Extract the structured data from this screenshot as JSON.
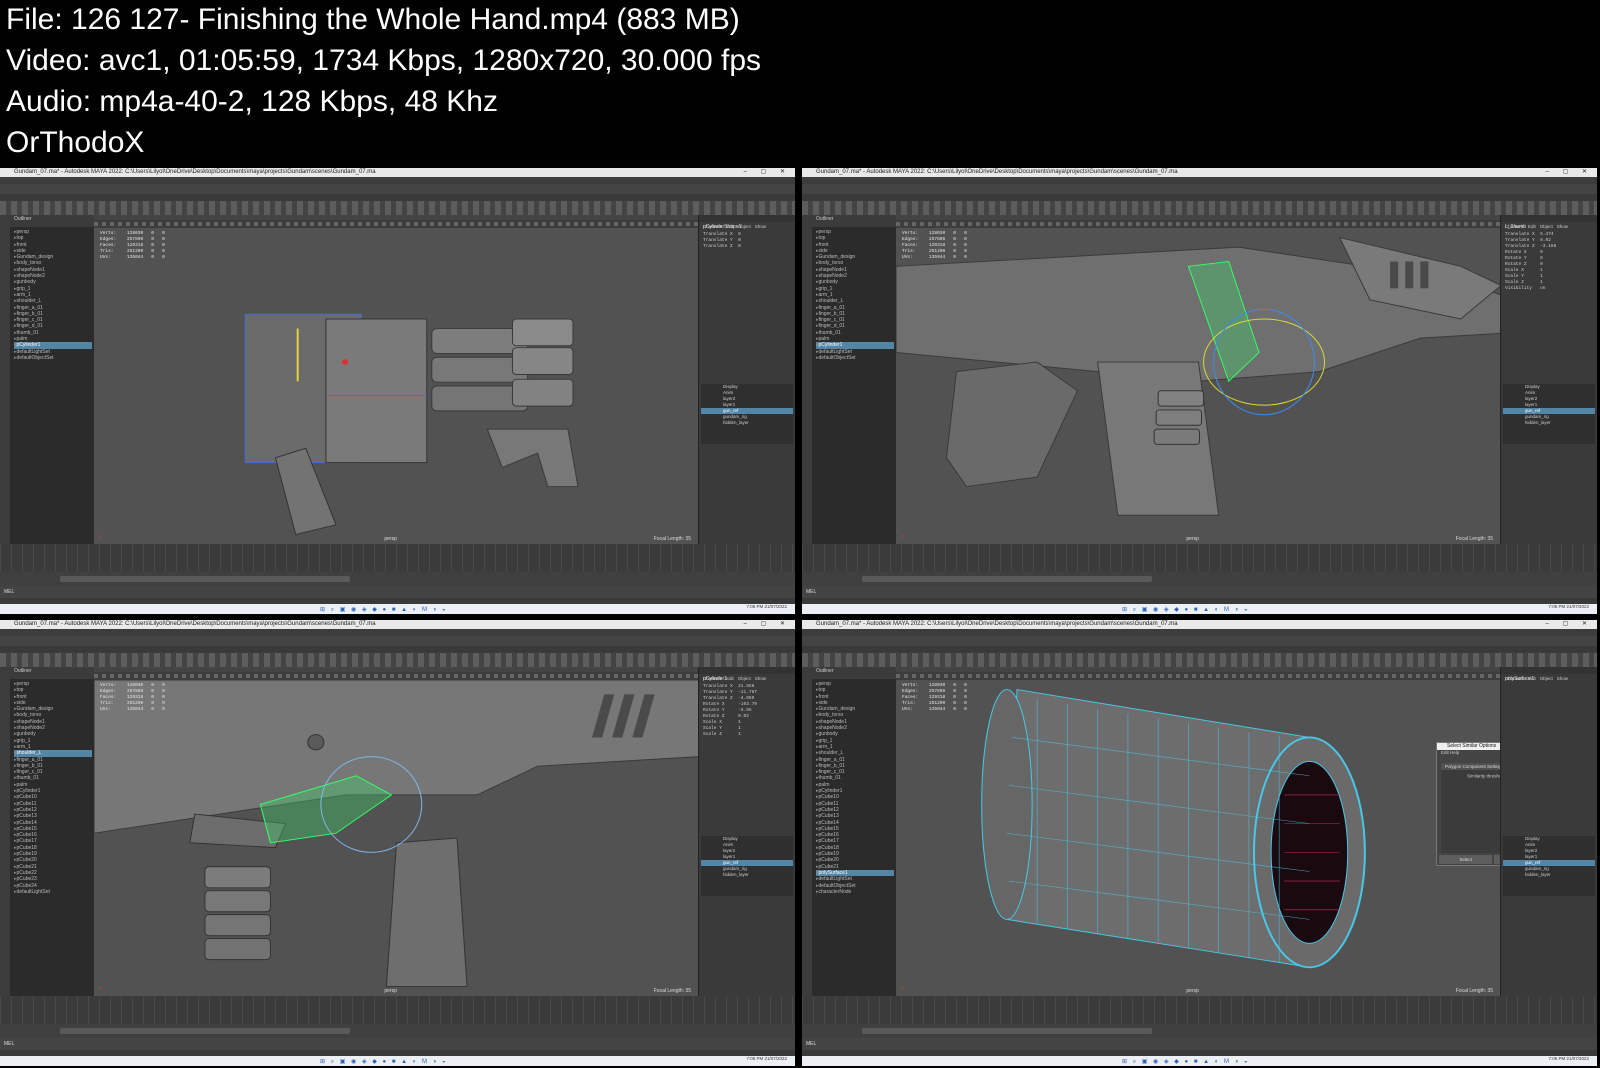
{
  "info": {
    "file_line": "File: 126  127- Finishing the Whole Hand.mp4 (883 MB)",
    "video_line": "Video: avc1, 01:05:59, 1734 Kbps, 1280x720, 30.000 fps",
    "audio_line": "Audio: mp4a-40-2, 128 Kbps, 48 Khz",
    "author": "OrThodoX"
  },
  "maya": {
    "title": "Gundam_07.ma* - Autodesk MAYA 2022: C:\\Users\\Lilyol\\OneDrive\\Desktop\\Documents\\maya\\projects\\Gundam\\scenes\\Gundam_07.ma",
    "window_controls": "– ▢ ✕",
    "menus": [
      "File",
      "Edit",
      "Create",
      "Select",
      "Modify",
      "Display",
      "Windows",
      "Mesh",
      "Edit Mesh",
      "Mesh Tools",
      "Mesh Display",
      "Curves",
      "Surfaces",
      "Deform",
      "UV",
      "Generate",
      "Cache",
      "Arnold",
      "Help"
    ],
    "shelf_tabs": [
      "Curves / Surfaces",
      "Poly Modeling",
      "Sculpting",
      "Rigging",
      "Animation",
      "Rendering",
      "FX",
      "FX Caching",
      "Custom",
      "Arnold",
      "Bifrost",
      "MASH",
      "Motion Graphics",
      "XGen"
    ],
    "panel_menus": [
      "View",
      "Shading",
      "Lighting",
      "Show",
      "Renderer",
      "Panels"
    ],
    "outliner_header": "Outliner",
    "hud": "Verts:    128030   0   0\nEdges:    257896   0   0\nFaces:    129318   0   0\nTris:     251290   0   0\nUVs:      135044   0   0",
    "persp_label": "persp",
    "focal_label": "Focal Length:   35",
    "channel_tabs": [
      "Channels",
      "Edit",
      "Object",
      "Show"
    ],
    "layer_tabs": [
      "Display",
      "Anim"
    ],
    "mel_label": "MEL",
    "taskbar_icons": "⊞ ⌕ ▣ ◉ ◈ ◆ ● ■ ▲ ◐ M ◑ ◒",
    "clock": "7:05 PM\n21/07/2022"
  },
  "shots": [
    {
      "outliner": [
        "persp",
        "top",
        "front",
        "side",
        "Gundam_design",
        "body_torso",
        "shapeNode1",
        "shapeNode2",
        "gunbody",
        "grip_1",
        "arm_1",
        "shoulder_L",
        "finger_a_01",
        "finger_b_01",
        "finger_c_01",
        "finger_d_01",
        "thumb_01",
        "palm",
        "pCylinder1",
        "defaultLightSet",
        "defaultObjectSet"
      ],
      "sel": 18,
      "channel_object": "pCylinderShape1",
      "channel_attrs": "Translate X  0\nTranslate Y  0\nTranslate Z  0",
      "layers": [
        "layer2",
        "layer1",
        "gun_ref",
        "gundam_rig",
        "hidden_layer"
      ]
    },
    {
      "outliner": [
        "persp",
        "top",
        "front",
        "side",
        "Gundam_design",
        "body_torso",
        "shapeNode1",
        "shapeNode2",
        "gunbody",
        "grip_1",
        "arm_1",
        "shoulder_L",
        "finger_a_01",
        "finger_b_01",
        "finger_c_01",
        "finger_d_01",
        "thumb_01",
        "palm",
        "pCylinder1",
        "defaultLightSet",
        "defaultObjectSet"
      ],
      "sel": 18,
      "channel_object": "L_Thumb",
      "channel_attrs": "Translate X  5.474\nTranslate Y  8.02\nTranslate Z  -3.168\nRotate X     0\nRotate Y     0\nRotate Z     0\nScale X      1\nScale Y      1\nScale Z      1\nVisibility   on",
      "layers": [
        "layer2",
        "layer1",
        "gun_ref",
        "gundam_rig",
        "hidden_layer"
      ]
    },
    {
      "outliner": [
        "persp",
        "top",
        "front",
        "side",
        "Gundam_design",
        "body_torso",
        "shapeNode1",
        "shapeNode2",
        "gunbody",
        "grip_1",
        "arm_1",
        "shoulder_L",
        "finger_a_01",
        "finger_b_01",
        "finger_c_01",
        "thumb_01",
        "palm",
        "pCylinder1",
        "pCube10",
        "pCube11",
        "pCube12",
        "pCube13",
        "pCube14",
        "pCube15",
        "pCube16",
        "pCube17",
        "pCube18",
        "pCube19",
        "pCube20",
        "pCube21",
        "pCube22",
        "pCube23",
        "pCube24",
        "defaultLightSet"
      ],
      "sel": 11,
      "channel_object": "pCylinder1",
      "channel_attrs": "Translate X  21.558\nTranslate Y  -11.787\nTranslate Z  -4.069\nRotate X     -103.79\nRotate Y     -5.65\nRotate Z     0.02\nScale X      1\nScale Y      1\nScale Z      1",
      "layers": [
        "layer2",
        "layer1",
        "gun_ref",
        "gundam_rig",
        "hidden_layer"
      ]
    },
    {
      "outliner": [
        "persp",
        "top",
        "front",
        "side",
        "Gundam_design",
        "body_torso",
        "shapeNode1",
        "shapeNode2",
        "gunbody",
        "grip_1",
        "arm_1",
        "shoulder_L",
        "finger_a_01",
        "finger_b_01",
        "finger_c_01",
        "thumb_01",
        "palm",
        "pCylinder1",
        "pCube10",
        "pCube11",
        "pCube12",
        "pCube13",
        "pCube14",
        "pCube15",
        "pCube16",
        "pCube17",
        "pCube18",
        "pCube19",
        "pCube20",
        "pCube21",
        "polySurface1",
        "defaultLightSet",
        "defaultObjectSet",
        "characterNode"
      ],
      "sel": 30,
      "channel_object": "polySurface1",
      "channel_attrs": "",
      "layers": [
        "layer2",
        "layer1",
        "gun_ref",
        "gundam_rig",
        "hidden_layer"
      ],
      "dialog": {
        "title": "Select Similar Options",
        "window_controls": "– ▢ ✕",
        "menus": "Edit   Help",
        "section": "Polygon Component Settings",
        "field_label": "Similarity threshold",
        "field_value": "0.0100",
        "buttons": [
          "Select",
          "Apply",
          "Close"
        ]
      }
    }
  ]
}
